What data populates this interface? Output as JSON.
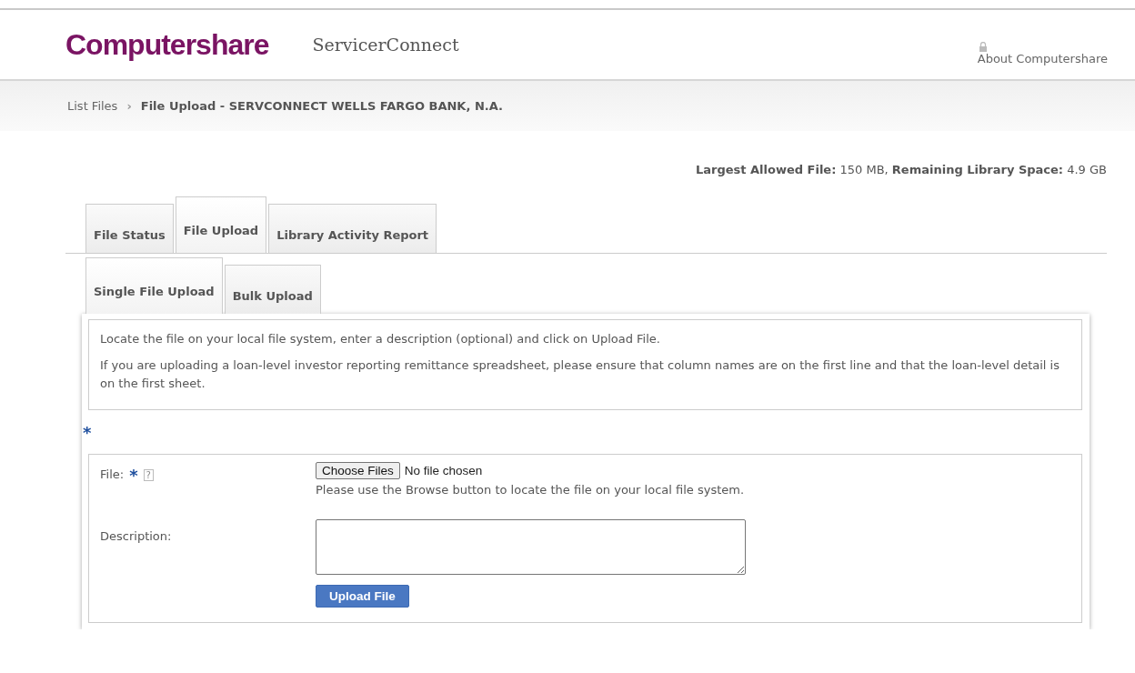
{
  "header": {
    "logo": "Computershare",
    "app_name": "ServicerConnect",
    "about_link": "About Computershare"
  },
  "breadcrumb": {
    "parent": "List Files",
    "separator": "›",
    "current": "File Upload - SERVCONNECT WELLS FARGO BANK, N.A."
  },
  "limits": "**Largest Allowed File:** 150 MB, **Remaining Library Space:** 4.9 GB",
  "tabs": [
    {
      "label": "File Status",
      "selected": false
    },
    {
      "label": "File Upload",
      "selected": true
    },
    {
      "label": "Library Activity Report",
      "selected": false
    }
  ],
  "subtabs": [
    {
      "label": "Single File Upload",
      "selected": true
    },
    {
      "label": "Bulk Upload",
      "selected": false
    }
  ],
  "instructions": [
    "Locate the file on your local file system, enter a description (optional) and click on Upload File.",
    "If you are uploading a loan-level investor reporting remittance spreadsheet, please ensure that column names are on the first line and that the loan-level detail is on the first sheet."
  ],
  "required_mark": "*",
  "form": {
    "file_label": "File:",
    "file_required_mark": "*",
    "help_mark": "?",
    "choose_button": "Choose Files",
    "file_status": "No file chosen",
    "file_hint": "Please use the Browse button to locate the file on your local file system.",
    "description_label": "Description:",
    "upload_button": "Upload File"
  }
}
